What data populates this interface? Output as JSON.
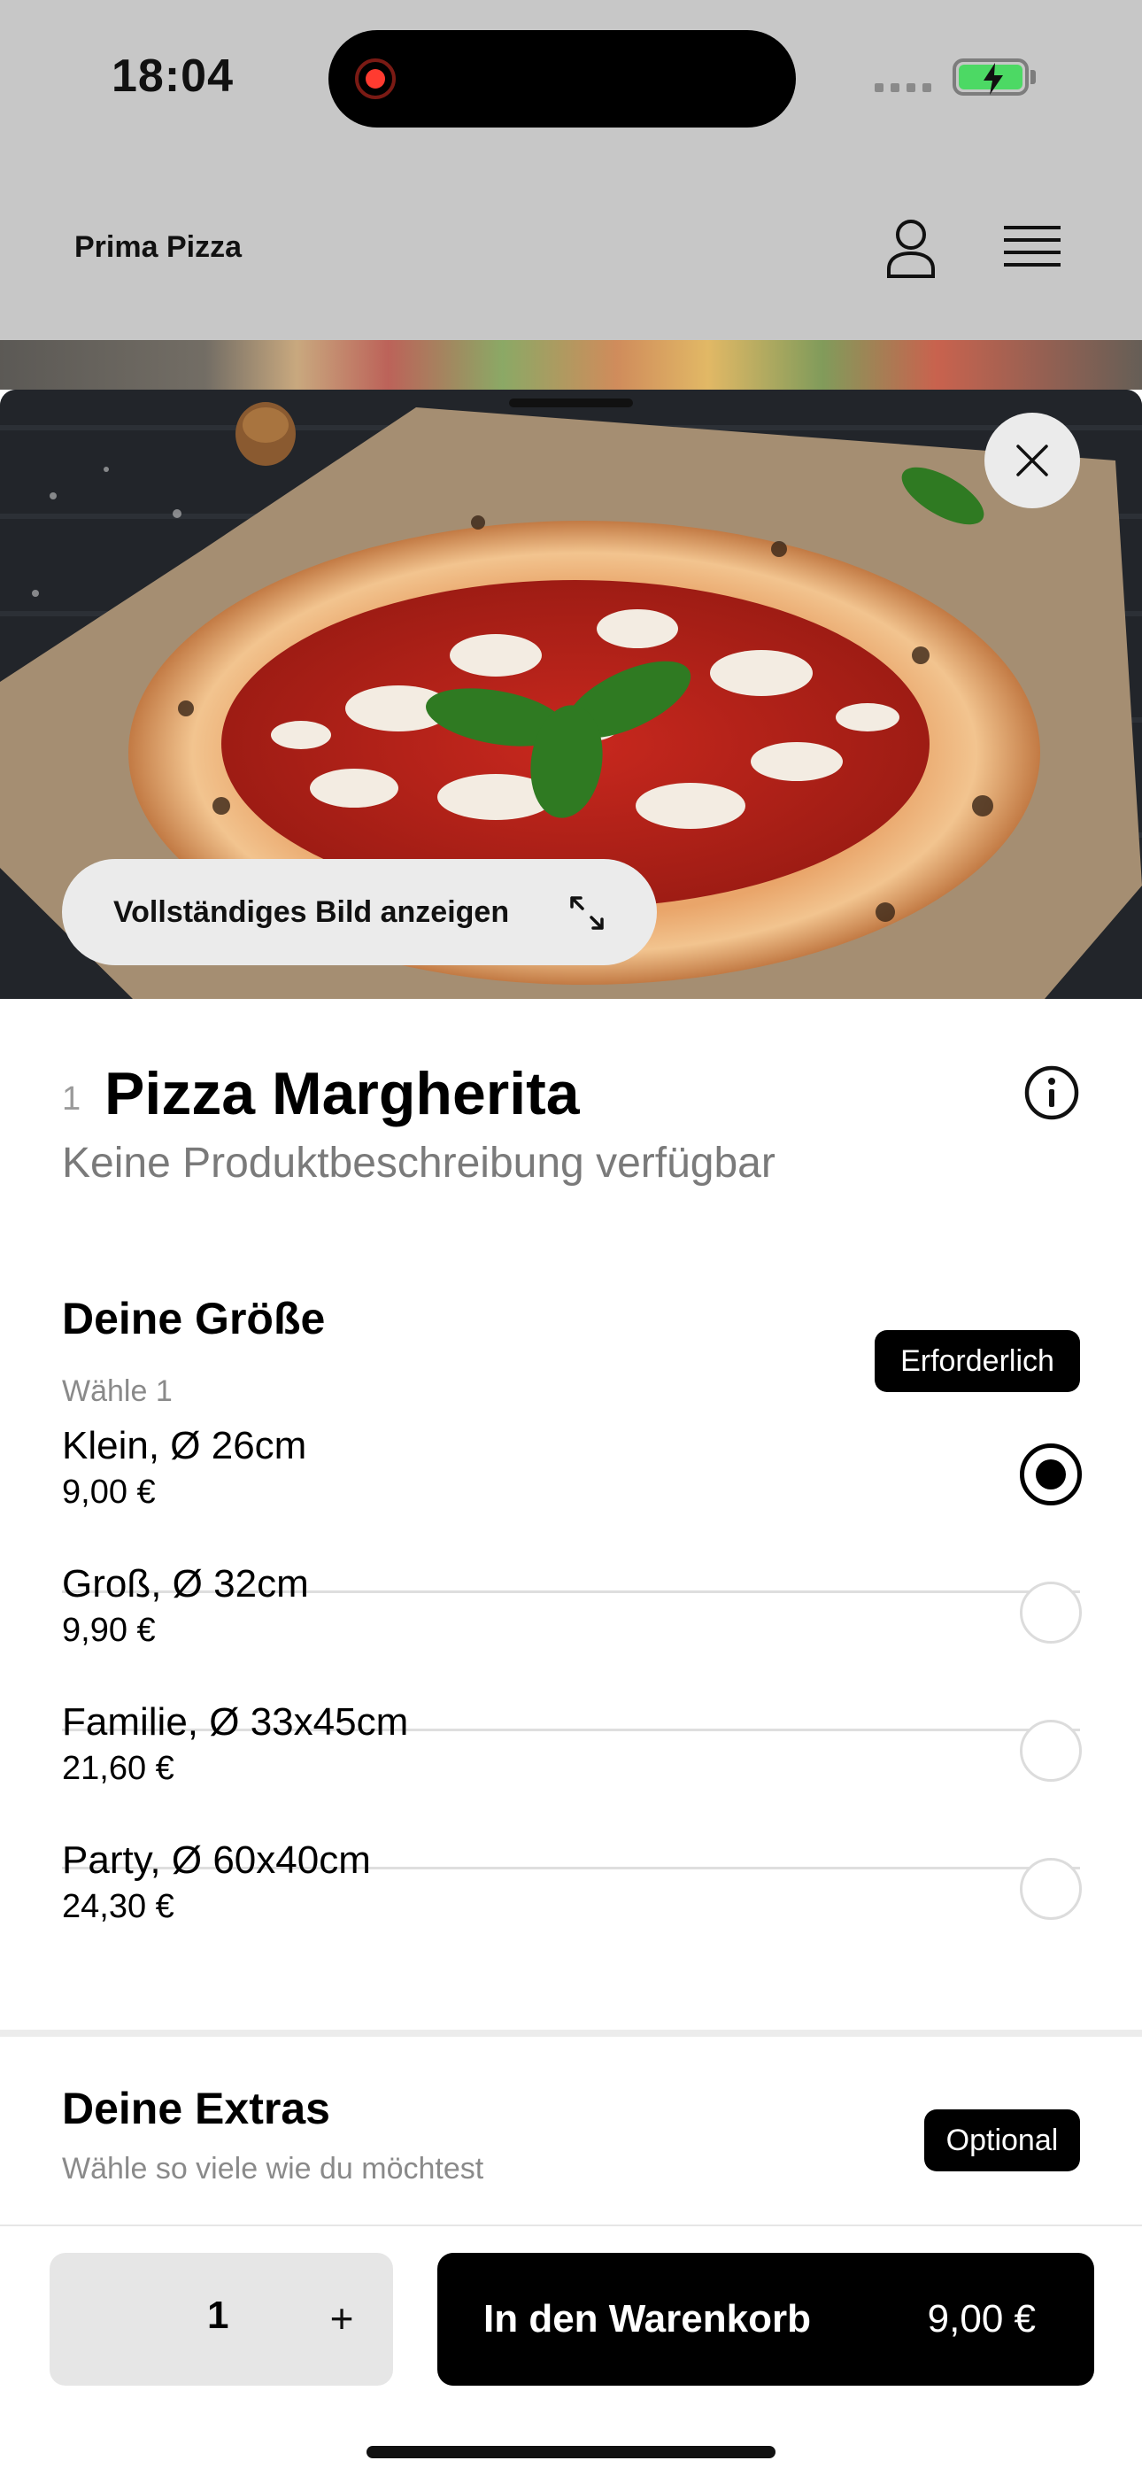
{
  "status_bar": {
    "time": "18:04"
  },
  "header": {
    "brand": "Prima Pizza"
  },
  "sheet": {
    "full_image_label": "Vollständiges Bild anzeigen",
    "product": {
      "number": "1",
      "title": "Pizza Margherita",
      "description": "Keine Produktbeschreibung verfügbar"
    },
    "size_group": {
      "title": "Deine Größe",
      "subtitle": "Wähle 1",
      "badge": "Erforderlich",
      "options": [
        {
          "name": "Klein, Ø 26cm",
          "price": "9,00 €",
          "selected": true
        },
        {
          "name": "Groß, Ø 32cm",
          "price": "9,90 €",
          "selected": false
        },
        {
          "name": "Familie, Ø 33x45cm",
          "price": "21,60 €",
          "selected": false
        },
        {
          "name": "Party, Ø 60x40cm",
          "price": "24,30 €",
          "selected": false
        }
      ]
    },
    "extras_group": {
      "title": "Deine Extras",
      "subtitle": "Wähle so viele wie du möchtest",
      "badge": "Optional"
    }
  },
  "bottom_bar": {
    "quantity": "1",
    "plus_label": "+",
    "cart_label": "In den Warenkorb",
    "cart_price": "9,00 €"
  },
  "colors": {
    "accent": "#000000",
    "battery": "#4cd964",
    "record": "#ff3b30"
  }
}
